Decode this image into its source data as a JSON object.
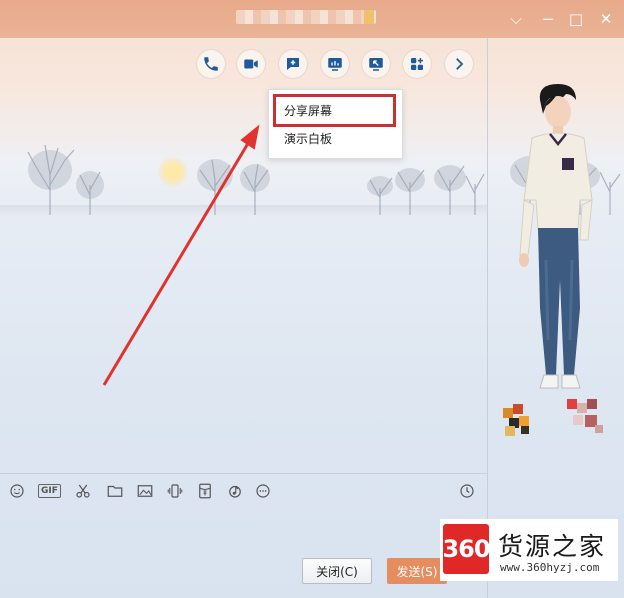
{
  "titlebar": {
    "title_text": "",
    "minimize": "⌵",
    "restore": "−",
    "maximize": "□",
    "close": "✕"
  },
  "toolbar": {
    "icons": [
      "phone-icon",
      "video-icon",
      "message-plus-icon",
      "screen-share-icon",
      "remote-assist-icon",
      "apps-icon",
      "chevron-right-icon"
    ],
    "accent_color": "#1f5b9a"
  },
  "dropdown": {
    "items": [
      "分享屏幕",
      "演示白板"
    ],
    "highlight_color": "#c9312e"
  },
  "input_toolbar": {
    "gif_label": "GIF",
    "icons": [
      "emoji-icon",
      "gif-icon",
      "scissors-icon",
      "folder-icon",
      "image-icon",
      "shake-icon",
      "red-packet-icon",
      "music-icon",
      "more-icon",
      "history-clock-icon"
    ]
  },
  "buttons": {
    "close_label": "关闭(C)",
    "send_label": "发送(S)"
  },
  "watermark": {
    "logo_text": "360",
    "title": "货源之家",
    "url": "www.360hyzj.com"
  },
  "colors": {
    "titlebar": "#e8a98a",
    "send_button": "#e58d5f",
    "arrow": "#e0332f"
  }
}
